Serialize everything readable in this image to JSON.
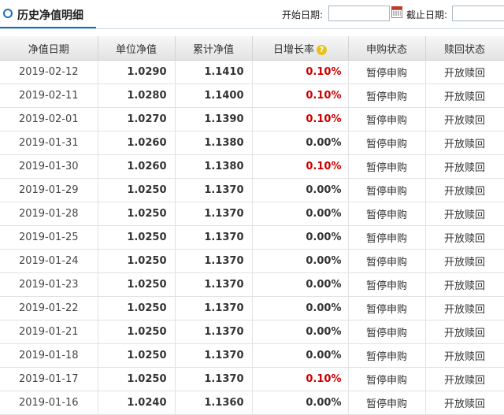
{
  "header": {
    "title": "历史净值明细",
    "start_label": "开始日期:",
    "end_label": "截止日期:",
    "start_value": "",
    "end_value": ""
  },
  "columns": [
    "净值日期",
    "单位净值",
    "累计净值",
    "日增长率",
    "申购状态",
    "赎回状态"
  ],
  "rows": [
    {
      "date": "2019-02-12",
      "nav": "1.0290",
      "acc": "1.1410",
      "rate": "0.10%",
      "rate_type": "pos",
      "buy": "暂停申购",
      "redeem": "开放赎回"
    },
    {
      "date": "2019-02-11",
      "nav": "1.0280",
      "acc": "1.1400",
      "rate": "0.10%",
      "rate_type": "pos",
      "buy": "暂停申购",
      "redeem": "开放赎回"
    },
    {
      "date": "2019-02-01",
      "nav": "1.0270",
      "acc": "1.1390",
      "rate": "0.10%",
      "rate_type": "pos",
      "buy": "暂停申购",
      "redeem": "开放赎回"
    },
    {
      "date": "2019-01-31",
      "nav": "1.0260",
      "acc": "1.1380",
      "rate": "0.00%",
      "rate_type": "zero",
      "buy": "暂停申购",
      "redeem": "开放赎回"
    },
    {
      "date": "2019-01-30",
      "nav": "1.0260",
      "acc": "1.1380",
      "rate": "0.10%",
      "rate_type": "pos",
      "buy": "暂停申购",
      "redeem": "开放赎回"
    },
    {
      "date": "2019-01-29",
      "nav": "1.0250",
      "acc": "1.1370",
      "rate": "0.00%",
      "rate_type": "zero",
      "buy": "暂停申购",
      "redeem": "开放赎回"
    },
    {
      "date": "2019-01-28",
      "nav": "1.0250",
      "acc": "1.1370",
      "rate": "0.00%",
      "rate_type": "zero",
      "buy": "暂停申购",
      "redeem": "开放赎回"
    },
    {
      "date": "2019-01-25",
      "nav": "1.0250",
      "acc": "1.1370",
      "rate": "0.00%",
      "rate_type": "zero",
      "buy": "暂停申购",
      "redeem": "开放赎回"
    },
    {
      "date": "2019-01-24",
      "nav": "1.0250",
      "acc": "1.1370",
      "rate": "0.00%",
      "rate_type": "zero",
      "buy": "暂停申购",
      "redeem": "开放赎回"
    },
    {
      "date": "2019-01-23",
      "nav": "1.0250",
      "acc": "1.1370",
      "rate": "0.00%",
      "rate_type": "zero",
      "buy": "暂停申购",
      "redeem": "开放赎回"
    },
    {
      "date": "2019-01-22",
      "nav": "1.0250",
      "acc": "1.1370",
      "rate": "0.00%",
      "rate_type": "zero",
      "buy": "暂停申购",
      "redeem": "开放赎回"
    },
    {
      "date": "2019-01-21",
      "nav": "1.0250",
      "acc": "1.1370",
      "rate": "0.00%",
      "rate_type": "zero",
      "buy": "暂停申购",
      "redeem": "开放赎回"
    },
    {
      "date": "2019-01-18",
      "nav": "1.0250",
      "acc": "1.1370",
      "rate": "0.00%",
      "rate_type": "zero",
      "buy": "暂停申购",
      "redeem": "开放赎回"
    },
    {
      "date": "2019-01-17",
      "nav": "1.0250",
      "acc": "1.1370",
      "rate": "0.10%",
      "rate_type": "pos",
      "buy": "暂停申购",
      "redeem": "开放赎回"
    },
    {
      "date": "2019-01-16",
      "nav": "1.0240",
      "acc": "1.1360",
      "rate": "0.00%",
      "rate_type": "zero",
      "buy": "暂停申购",
      "redeem": "开放赎回"
    }
  ],
  "icons": {
    "help": "question-icon",
    "calendar": "calendar-icon",
    "bullet": "circle-bullet-icon"
  },
  "colors": {
    "accent": "#1d6fb8",
    "positive": "#cc0000"
  }
}
